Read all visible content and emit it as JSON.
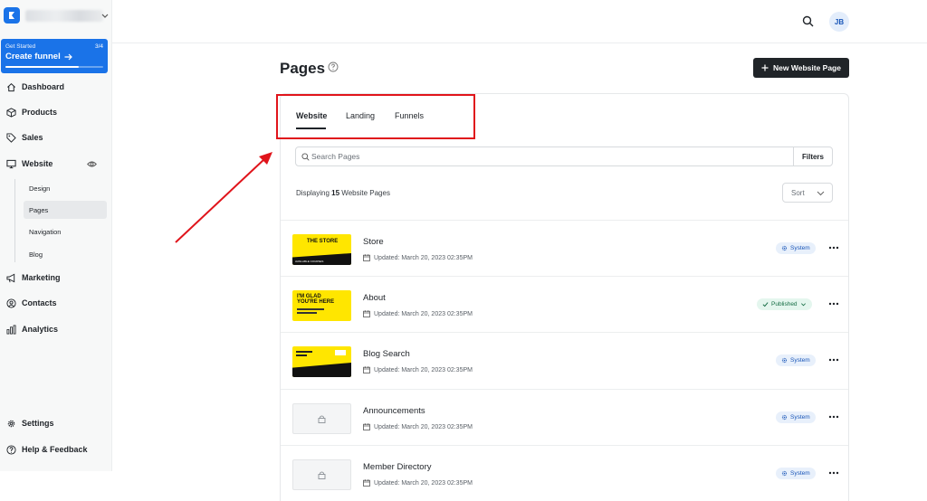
{
  "sidebar": {
    "get_started": {
      "label": "Get Started",
      "progress_text": "3/4",
      "progress": 0.75,
      "title": "Create funnel"
    },
    "items": [
      {
        "label": "Dashboard",
        "icon": "home-icon"
      },
      {
        "label": "Products",
        "icon": "box-icon"
      },
      {
        "label": "Sales",
        "icon": "tag-icon"
      },
      {
        "label": "Website",
        "icon": "monitor-icon"
      },
      {
        "label": "Marketing",
        "icon": "megaphone-icon"
      },
      {
        "label": "Contacts",
        "icon": "contact-icon"
      },
      {
        "label": "Analytics",
        "icon": "chart-icon"
      }
    ],
    "website_sub": [
      "Design",
      "Pages",
      "Navigation",
      "Blog"
    ],
    "active_sub": "Pages",
    "footer": [
      {
        "label": "Settings",
        "icon": "gear-icon"
      },
      {
        "label": "Help & Feedback",
        "icon": "help-icon"
      }
    ]
  },
  "header": {
    "avatar_initials": "JB"
  },
  "main": {
    "title": "Pages",
    "new_button": "New Website Page",
    "tabs": [
      "Website",
      "Landing",
      "Funnels"
    ],
    "active_tab": "Website",
    "search_placeholder": "Search Pages",
    "filters_label": "Filters",
    "displaying_prefix": "Displaying",
    "displaying_count": "15",
    "displaying_suffix": "Website Pages",
    "sort_label": "Sort",
    "pages": [
      {
        "title": "Store",
        "updated": "Updated: March 20, 2023 02:35PM",
        "status": "System",
        "thumb_text": "THE STORE",
        "thumb_sub": "AVAILABLE COURSES"
      },
      {
        "title": "About",
        "updated": "Updated: March 20, 2023 02:35PM",
        "status": "Published",
        "thumb_text": "I'M GLAD YOU'RE HERE",
        "thumb_sub": ""
      },
      {
        "title": "Blog Search",
        "updated": "Updated: March 20, 2023 02:35PM",
        "status": "System",
        "thumb_text": "",
        "thumb_sub": ""
      },
      {
        "title": "Announcements",
        "updated": "Updated: March 20, 2023 02:35PM",
        "status": "System",
        "thumb_text": "",
        "thumb_sub": ""
      },
      {
        "title": "Member Directory",
        "updated": "Updated: March 20, 2023 02:35PM",
        "status": "System",
        "thumb_text": "",
        "thumb_sub": ""
      }
    ]
  },
  "colors": {
    "brand": "#1a73e8",
    "highlight": "#e0141b",
    "primary_button": "#202428",
    "system_badge": "#1a56b8",
    "published_badge": "#146c43"
  }
}
